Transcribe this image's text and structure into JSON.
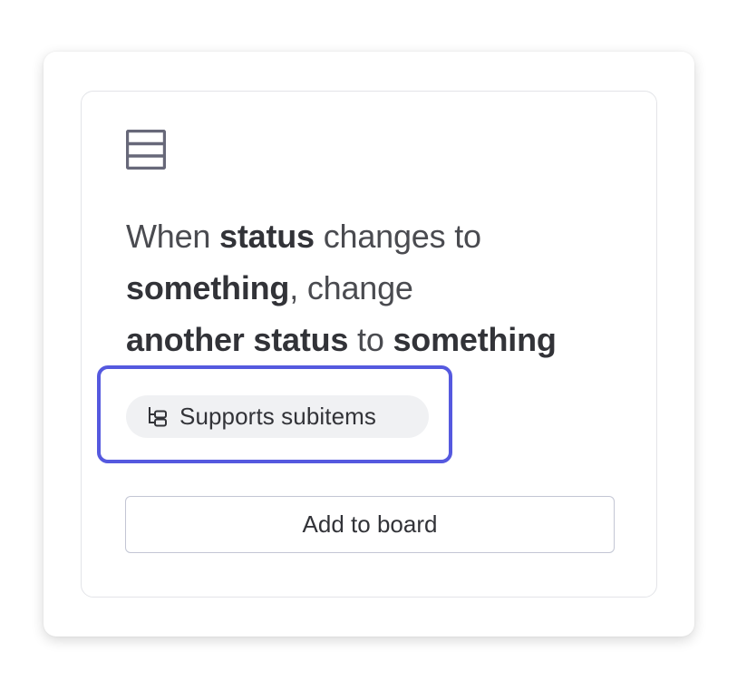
{
  "recipe": {
    "icon": "table-rows-icon",
    "sentence": [
      {
        "text": "When ",
        "style": "plain"
      },
      {
        "text": "status",
        "style": "kw"
      },
      {
        "text": " changes to",
        "style": "plain"
      },
      {
        "text": "something",
        "style": "kw"
      },
      {
        "text": ", change",
        "style": "plain"
      },
      {
        "text": "another status",
        "style": "kw"
      },
      {
        "text": " to ",
        "style": "plain"
      },
      {
        "text": "something",
        "style": "kw"
      }
    ]
  },
  "tag": {
    "icon": "subitems-tree-icon",
    "label": "Supports subitems"
  },
  "actions": {
    "add_label": "Add to board"
  },
  "colors": {
    "highlight": "#5559df",
    "text": "#323338",
    "icon": "#676879",
    "tag_bg": "#f0f1f3"
  }
}
